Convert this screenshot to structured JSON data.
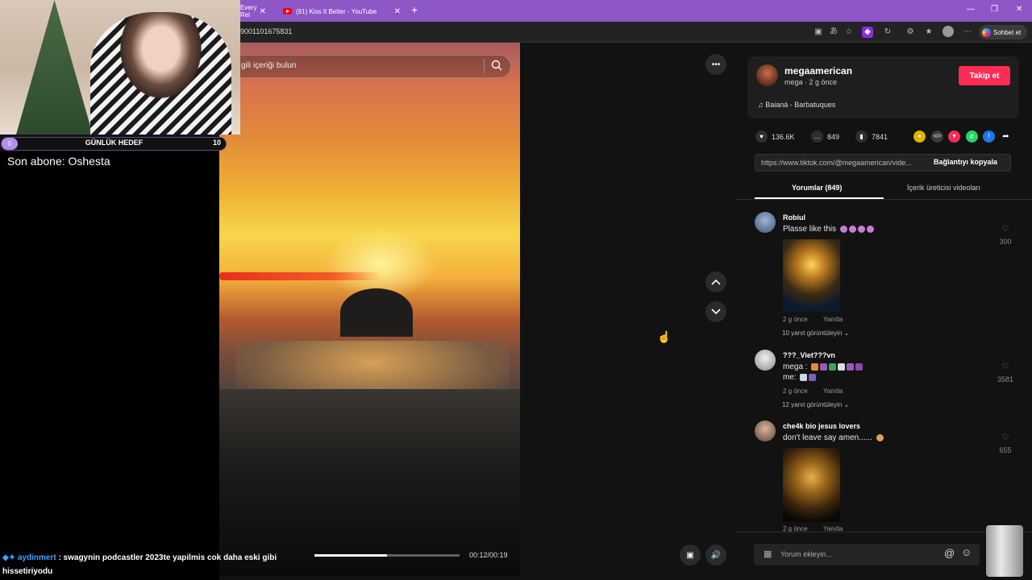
{
  "browser": {
    "tabs": [
      {
        "title": "Every Rel"
      },
      {
        "title": "(91) Kiss It Better - YouTube"
      }
    ],
    "new_tab": "+",
    "url": "9001101675831",
    "window_controls": [
      "—",
      "❐",
      "✕"
    ],
    "copilot_label": "Sohbet et"
  },
  "video": {
    "search_placeholder": "gili içeriği bulun",
    "more_icon": "•••",
    "progress": 0.5,
    "time": "00:12/00:19",
    "up_icon": "chevron-up-icon",
    "down_icon": "chevron-down-icon"
  },
  "author": {
    "name": "megaamerican",
    "meta": "mega · 2 g önce",
    "follow_label": "Takip et",
    "music": "Baianá - Barbatuques"
  },
  "stats": {
    "likes": "136.6K",
    "comments": "849",
    "saves": "7841"
  },
  "share_colors": [
    "#e0b400",
    "#3a3a3a",
    "#fe2c55",
    "#25d366",
    "#1877f2",
    "#121212"
  ],
  "link": {
    "url": "https://www.tiktok.com/@megaamerican/vide...",
    "copy_label": "Bağlantıyı kopyala"
  },
  "panel_tabs": [
    {
      "label": "Yorumlar (849)"
    },
    {
      "label": "İçerik üreticisi videoları"
    }
  ],
  "comments": [
    {
      "user": "Robiul",
      "lines": [
        "Plasse like this"
      ],
      "date": "2 g önce",
      "reply": "Yanıtla",
      "replies": "10 yanıt görüntüleyin",
      "likes": "300"
    },
    {
      "user": "???_Viet???vn",
      "lines": [
        "mega :",
        "me:"
      ],
      "date": "2 g önce",
      "reply": "Yanıtla",
      "replies": "12 yanıt görüntüleyin",
      "likes": "3581"
    },
    {
      "user": "che4k bio jesus lovers",
      "lines": [
        "don't leave say amen......"
      ],
      "date": "2 g önce",
      "reply": "Yanıtla",
      "likes": "655"
    }
  ],
  "comment_input": {
    "placeholder": "Yorum ekleyin..."
  },
  "stream": {
    "goal_label": "GÜNLÜK HEDEF",
    "goal_current": "0",
    "goal_max": "10",
    "sub_text": "Son abone: Oshesta",
    "chat_user": "aydinmert",
    "chat_message": ": swagynin podcastler 2023te yapilmis cok daha eski gibi",
    "chat_message_2": "hissetiriyodu"
  }
}
